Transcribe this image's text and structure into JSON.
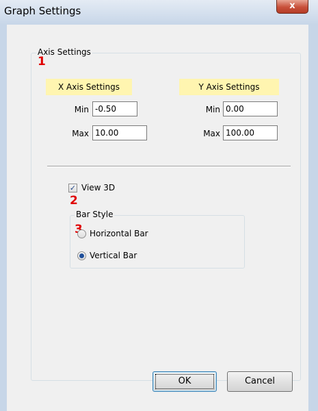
{
  "window": {
    "title": "Graph Settings",
    "close_label": "x"
  },
  "axis_settings": {
    "legend": "Axis Settings",
    "x_axis": {
      "header": "X Axis Settings",
      "min_label": "Min",
      "min_value": "-0.50",
      "max_label": "Max",
      "max_value": "10.00"
    },
    "y_axis": {
      "header": "Y Axis Settings",
      "min_label": "Min",
      "min_value": "0.00",
      "max_label": "Max",
      "max_value": "100.00"
    }
  },
  "view_3d": {
    "label": "View 3D",
    "checked": true
  },
  "bar_style": {
    "legend": "Bar Style",
    "options": [
      {
        "label": "Horizontal Bar",
        "selected": false
      },
      {
        "label": "Vertical Bar",
        "selected": true
      }
    ]
  },
  "markers": [
    "1",
    "2",
    "3"
  ],
  "buttons": {
    "ok": "OK",
    "cancel": "Cancel"
  }
}
